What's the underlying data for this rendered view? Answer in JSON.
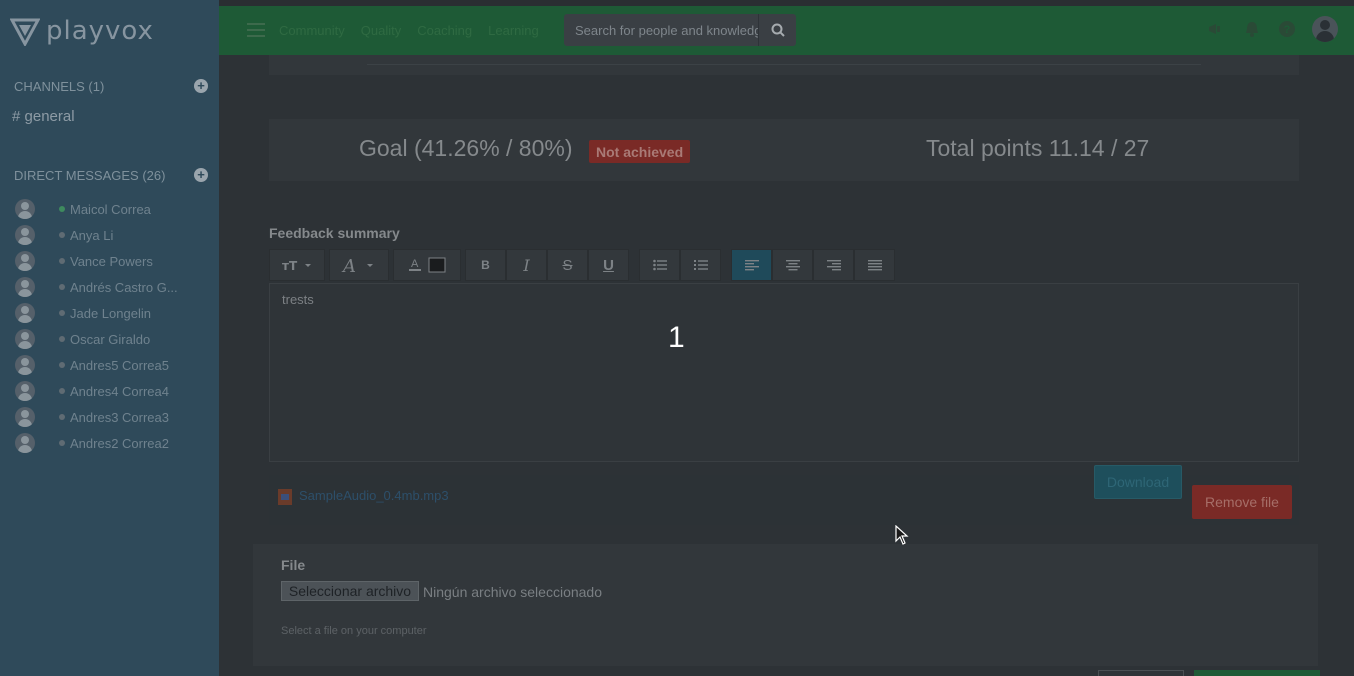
{
  "brand": {
    "name": "playvox"
  },
  "sidebar": {
    "channels_title": "CHANNELS (1)",
    "channel": "# general",
    "dm_title": "DIRECT MESSAGES (26)",
    "dms": [
      {
        "name": "Maicol Correa",
        "online": true
      },
      {
        "name": "Anya Li",
        "online": false
      },
      {
        "name": "Vance Powers",
        "online": false
      },
      {
        "name": "Andrés Castro G...",
        "online": false
      },
      {
        "name": "Jade Longelin",
        "online": false
      },
      {
        "name": "Oscar Giraldo",
        "online": false
      },
      {
        "name": "Andres5 Correa5",
        "online": false
      },
      {
        "name": "Andres4 Correa4",
        "online": false
      },
      {
        "name": "Andres3 Correa3",
        "online": false
      },
      {
        "name": "Andres2 Correa2",
        "online": false
      }
    ]
  },
  "topbar": {
    "nav": [
      "Community",
      "Quality",
      "Coaching",
      "Learning"
    ],
    "search_placeholder": "Search for people and knowledge"
  },
  "goal": {
    "text": "Goal (41.26% / 80%)",
    "badge": "Not achieved",
    "points": "Total points 11.14 / 27"
  },
  "feedback": {
    "label": "Feedback summary",
    "text": "trests"
  },
  "overlay_number": "1",
  "attachment": {
    "filename": "SampleAudio_0.4mb.mp3",
    "download_label": "Download",
    "remove_label": "Remove file"
  },
  "file_upload": {
    "label": "File",
    "button": "Seleccionar archivo",
    "status": "Ningún archivo seleccionado",
    "help": "Select a file on your computer"
  },
  "colors": {
    "topbar": "#1e5a36",
    "sidebar": "#2f4a5a",
    "badge": "#7a2a26"
  }
}
